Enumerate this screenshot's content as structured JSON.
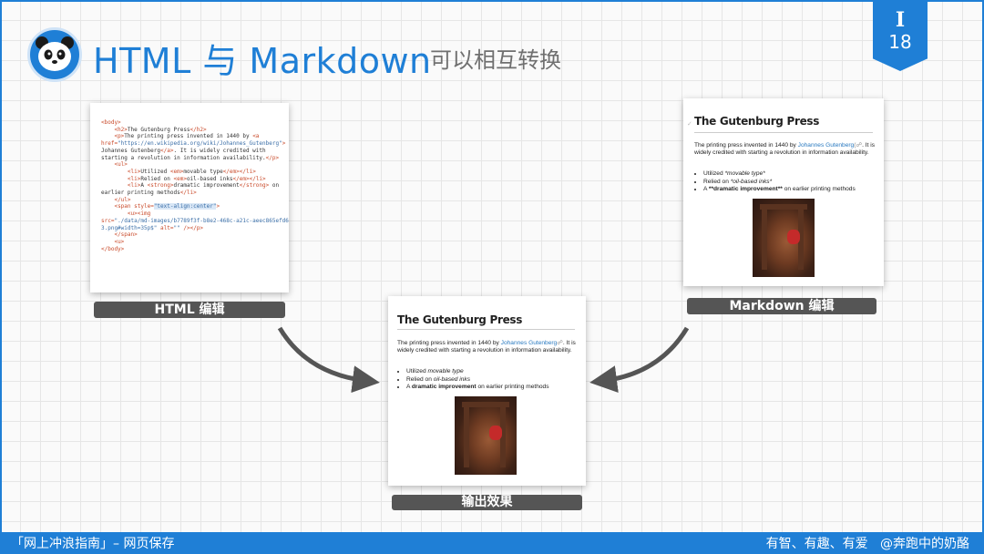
{
  "header": {
    "title": "HTML 与 Markdown",
    "subtitle": "可以相互转换",
    "logo_icon": "panda-icon",
    "accent_color": "#1f7fd6"
  },
  "page_badge": {
    "roman": "I",
    "number": "18"
  },
  "code_card": {
    "label": "HTML 编辑",
    "lines": [
      "<body>",
      "    <h2>The Gutenburg Press</h2>",
      "    <p>The printing press invented in 1440 by <a",
      "href=\"https://en.wikipedia.org/wiki/Johannes_Gutenberg\">",
      "Johannes Gutenberg</a>. It is widely credited with",
      "starting a revolution in information availability.</p>",
      "    <ul>",
      "        <li>Utilized <em>movable type</em></li>",
      "        <li>Relied on <em>oil-based inks</em></li>",
      "        <li>A <strong>dramatic improvement</strong> on",
      "earlier printing methods</li>",
      "    </ul>",
      "    <span style=\"text-align:center\">",
      "        <u><img",
      "src=\"./data/md-images/b7789f3f-b8e2-468c-a21c-aeec865efd6",
      "3.png#width=35p$\" alt=\"\" /></p>",
      "    </span>",
      "    <u>",
      "</body>"
    ]
  },
  "markdown_card": {
    "label": "Markdown 编辑",
    "heading": "The Gutenburg Press",
    "para_before_link": "The printing press invented in 1440 by ",
    "link": "Johannes Gutenberg",
    "para_after_link": ". It is widely credited with starting a revolution in information availability.",
    "items": [
      {
        "before": "Utilized ",
        "styled": "*movable type*",
        "after": ""
      },
      {
        "before": "Relied on ",
        "styled": "*oil-based inks*",
        "after": ""
      },
      {
        "before": "A ",
        "styled": "**dramatic improvement**",
        "after": " on earlier printing methods"
      }
    ]
  },
  "output_card": {
    "label": "输出效果",
    "heading": "The Gutenburg Press",
    "para_before_link": "The printing press invented in 1440 by ",
    "link": "Johannes Gutenberg",
    "para_after_link": ". It is widely credited with starting a revolution in information availability.",
    "items": [
      {
        "before": "Utilized ",
        "styled": "movable type",
        "after": ""
      },
      {
        "before": "Relied on ",
        "styled": "oil-based inks",
        "after": ""
      },
      {
        "before": "A ",
        "styled": "dramatic improvement",
        "after": " on earlier printing methods"
      }
    ]
  },
  "footer": {
    "left": "「网上冲浪指南」– 网页保存",
    "right": "有智、有趣、有爱   @奔跑中的奶酪",
    "bar_color": "#1f7fd6"
  }
}
